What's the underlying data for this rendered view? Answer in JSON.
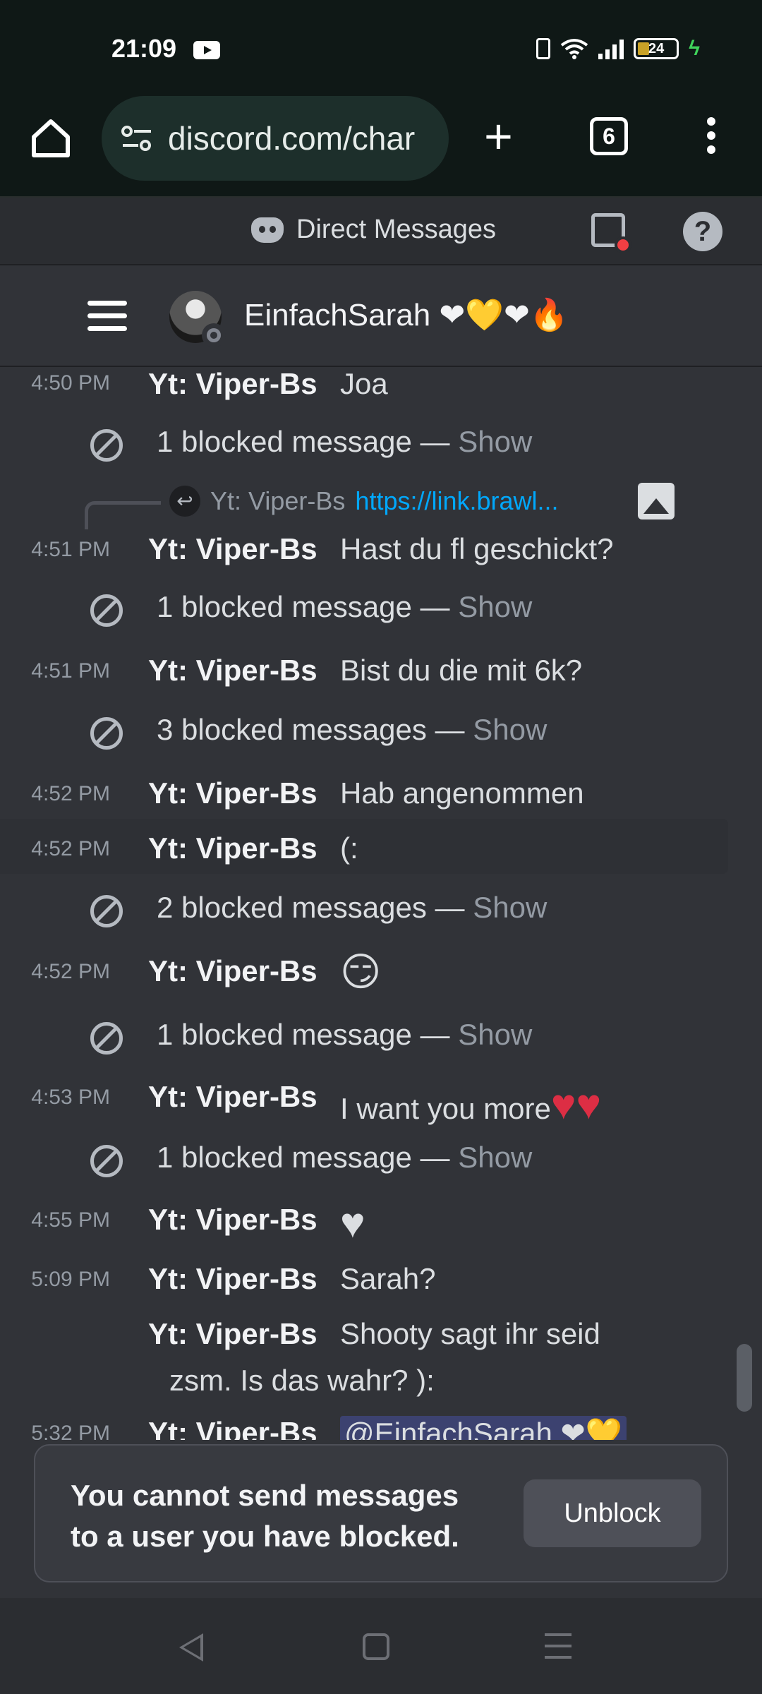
{
  "status_bar": {
    "time": "21:09",
    "battery": "24"
  },
  "browser": {
    "url": "discord.com/char",
    "tab_count": "6"
  },
  "dm_header": {
    "title": "Direct Messages",
    "help": "?"
  },
  "channel": {
    "name": "EinfachSarah ❤💛❤🔥"
  },
  "messages": [
    {
      "time": "4:50 PM",
      "author": "Yt: Viper-Bs",
      "content": "Joa"
    },
    {
      "blocked": "1 blocked message — ",
      "show": "Show"
    },
    {
      "reply_author": "Yt: Viper-Bs",
      "reply_link": "https://link.brawl..."
    },
    {
      "time": "4:51 PM",
      "author": "Yt: Viper-Bs",
      "content": "Hast du fl geschickt?"
    },
    {
      "blocked": "1 blocked message — ",
      "show": "Show"
    },
    {
      "time": "4:51 PM",
      "author": "Yt: Viper-Bs",
      "content": "Bist du die mit 6k?"
    },
    {
      "blocked": "3 blocked messages — ",
      "show": "Show"
    },
    {
      "time": "4:52 PM",
      "author": "Yt: Viper-Bs",
      "content": "Hab angenommen"
    },
    {
      "time": "4:52 PM",
      "author": "Yt: Viper-Bs",
      "content": "(:"
    },
    {
      "blocked": "2 blocked messages — ",
      "show": "Show"
    },
    {
      "time": "4:52 PM",
      "author": "Yt: Viper-Bs",
      "content": "😏"
    },
    {
      "blocked": "1 blocked message — ",
      "show": "Show"
    },
    {
      "time": "4:53 PM",
      "author": "Yt: Viper-Bs",
      "content": "I want you more",
      "hearts": "♥♥"
    },
    {
      "blocked": "1 blocked message — ",
      "show": "Show"
    },
    {
      "time": "4:55 PM",
      "author": "Yt: Viper-Bs",
      "content": "♥"
    },
    {
      "time": "5:09 PM",
      "author": "Yt: Viper-Bs",
      "content": "Sarah?"
    },
    {
      "author": "Yt: Viper-Bs",
      "content_line1": "Shooty sagt ihr seid",
      "content_line2": "zsm. Is das wahr? ):"
    },
    {
      "time": "5:32 PM",
      "author": "Yt: Viper-Bs",
      "content": "@EinfachSarah ❤💛"
    }
  ],
  "banner": {
    "text": "You cannot send messages to a user you have blocked.",
    "unblock_label": "Unblock"
  }
}
